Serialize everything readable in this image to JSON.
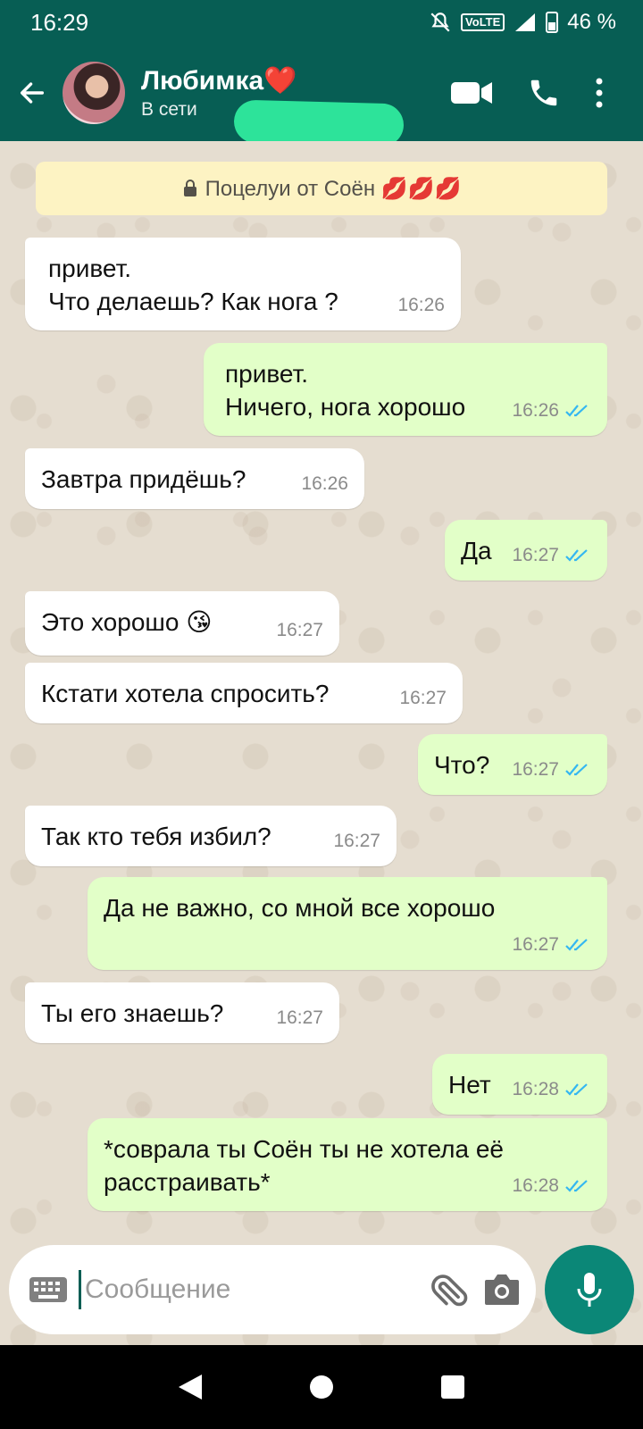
{
  "status_bar": {
    "time": "16:29",
    "network": "VoLTE 4G",
    "battery": "46 %"
  },
  "header": {
    "contact_name": "Любимка❤️",
    "contact_status": "В сети"
  },
  "encryption_notice": {
    "text": "Поцелуи от Соён 💋💋💋"
  },
  "messages": [
    {
      "direction": "in",
      "text": "привет.\nЧто делаешь? Как нога ?",
      "time": "16:26"
    },
    {
      "direction": "out",
      "text": "привет.\nНичего, нога хорошо",
      "time": "16:26",
      "status": "read"
    },
    {
      "direction": "in",
      "text": "Завтра придёшь?",
      "time": "16:26"
    },
    {
      "direction": "out",
      "text": "Да",
      "time": "16:27",
      "status": "read"
    },
    {
      "direction": "in",
      "text": "Это хорошо 😘",
      "time": "16:27"
    },
    {
      "direction": "in",
      "text": "Кстати хотела спросить?",
      "time": "16:27"
    },
    {
      "direction": "out",
      "text": "Что?",
      "time": "16:27",
      "status": "read"
    },
    {
      "direction": "in",
      "text": "Так кто тебя избил?",
      "time": "16:27"
    },
    {
      "direction": "out",
      "text": "Да не важно, со мной все хорошо",
      "time": "16:27",
      "status": "read"
    },
    {
      "direction": "in",
      "text": "Ты его знаешь?",
      "time": "16:27"
    },
    {
      "direction": "out",
      "text": "Нет",
      "time": "16:28",
      "status": "read"
    },
    {
      "direction": "out",
      "text": "*соврала ты Соён ты не хотела её\nрасстраивать*",
      "time": "16:28",
      "status": "read"
    }
  ],
  "composer": {
    "placeholder": "Сообщение"
  },
  "colors": {
    "header": "#075e54",
    "incoming_bubble": "#ffffff",
    "outgoing_bubble": "#e2ffc8",
    "read_ticks": "#34b7f1",
    "mic_button": "#0b8777"
  }
}
